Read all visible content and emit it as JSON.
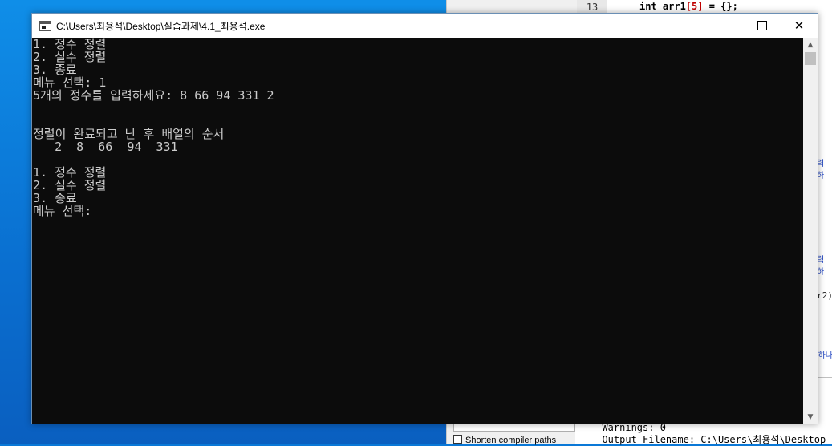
{
  "colors": {
    "console_bg": "#0c0c0c",
    "console_text": "#cccccc",
    "titlebar_bg": "#ffffff",
    "desktop": "#0a78d7"
  },
  "background_ide": {
    "line_number": "13",
    "code_prefix": "int arr1",
    "code_index": "[5]",
    "code_suffix": " = {};",
    "right_fragments": [
      "력 하",
      "력 하",
      "r2)",
      "하나"
    ],
    "output_log": [
      "- Warnings: 0",
      "- Output Filename: C:\\Users\\최용석\\Desktop"
    ],
    "checkbox_label": "Shorten compiler paths"
  },
  "console": {
    "title": "C:\\Users\\최용석\\Desktop\\실습과제\\4.1_최용석.exe",
    "controls": {
      "minimize_icon": "minimize-icon",
      "maximize_icon": "maximize-icon",
      "close_icon": "close-icon",
      "close_glyph": "✕"
    },
    "lines": [
      "1. 정수 정렬",
      "2. 실수 정렬",
      "3. 종료",
      "메뉴 선택: 1",
      "5개의 정수를 입력하세요: 8 66 94 331 2",
      "",
      "",
      "정렬이 완료되고 난 후 배열의 순서",
      "   2  8  66  94  331",
      "",
      "1. 정수 정렬",
      "2. 실수 정렬",
      "3. 종료",
      "메뉴 선택: "
    ]
  }
}
